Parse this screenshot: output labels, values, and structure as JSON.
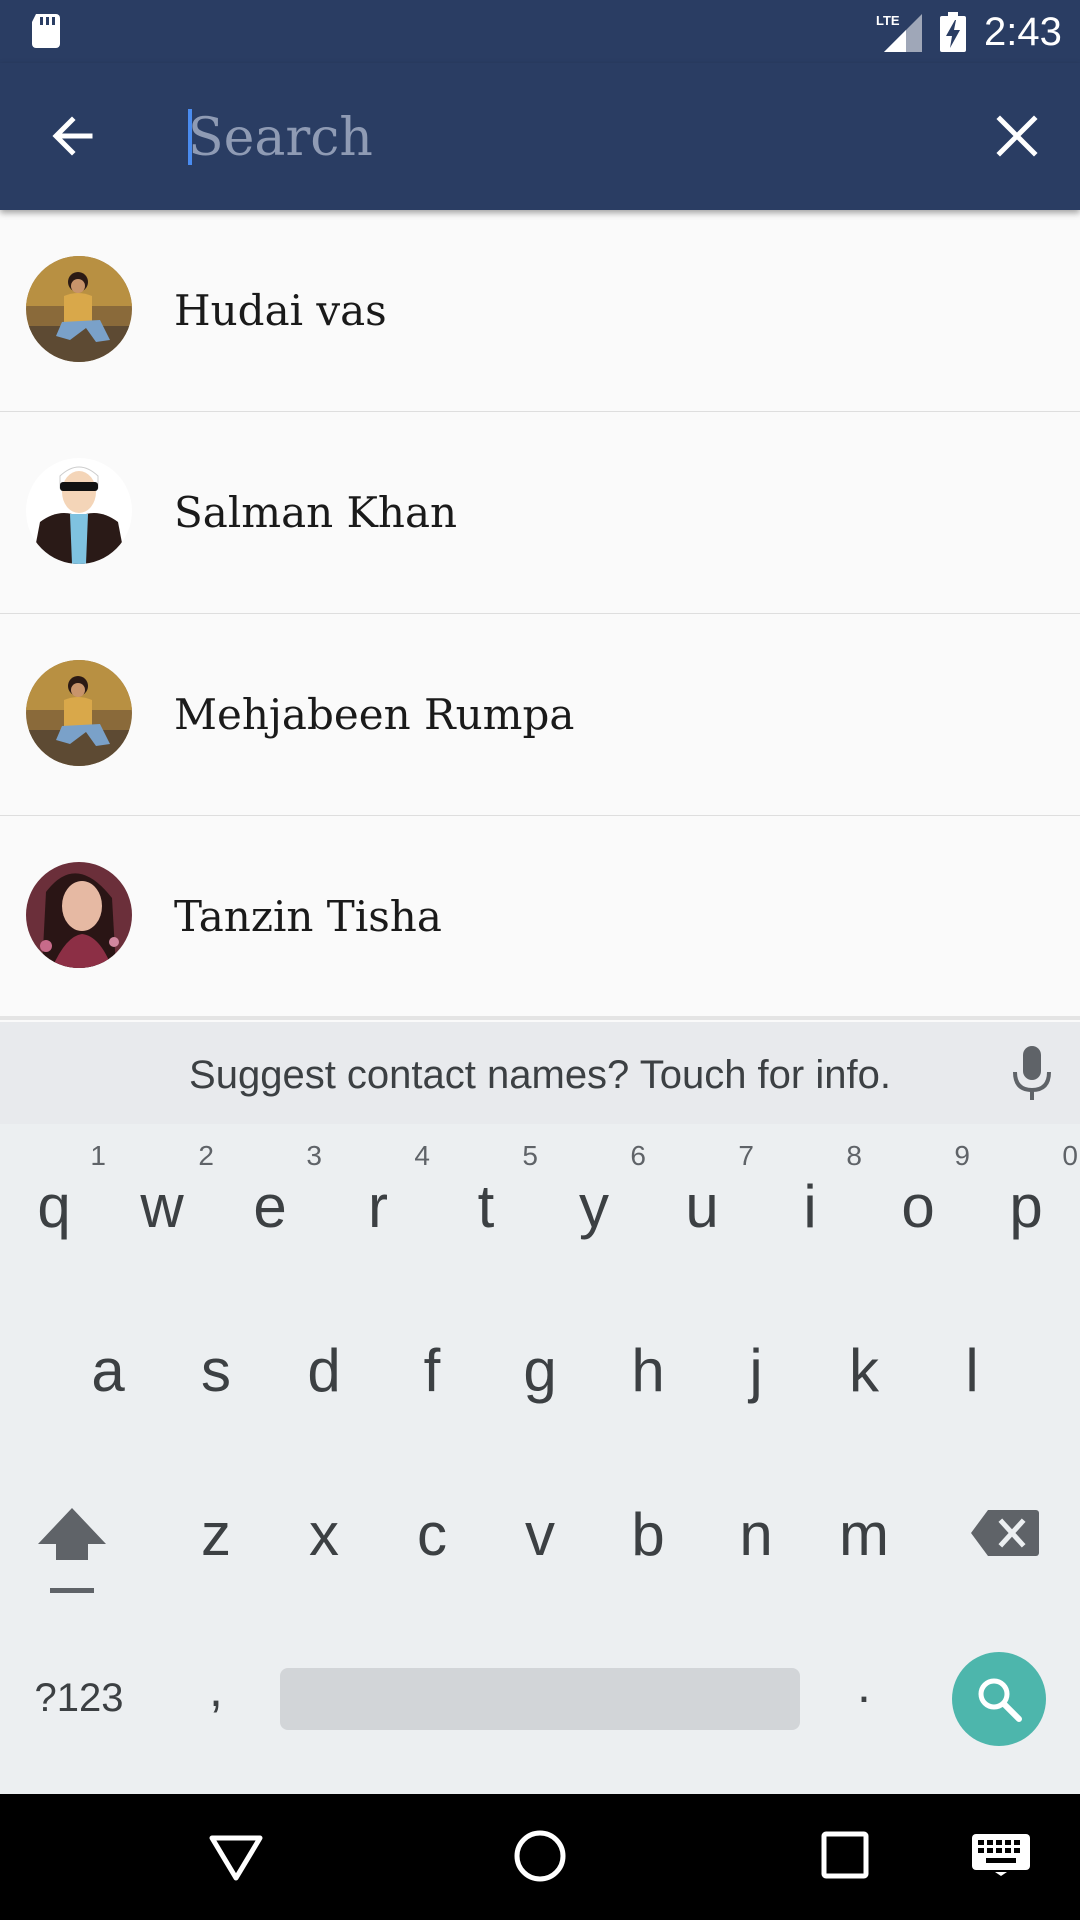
{
  "status_bar": {
    "time": "2:43",
    "network": "LTE",
    "icons": [
      "sd-card-icon",
      "lte-signal-icon",
      "battery-charging-icon"
    ]
  },
  "toolbar": {
    "back_icon": "arrow-back-icon",
    "search_placeholder": "Search",
    "search_value": "",
    "close_icon": "close-icon",
    "background": "#2a3d63"
  },
  "contacts": [
    {
      "name": "Hudai vas",
      "avatar": "photo-woman-sitting"
    },
    {
      "name": "Salman Khan",
      "avatar": "illustration-man-sunglasses"
    },
    {
      "name": "Mehjabeen Rumpa",
      "avatar": "photo-woman-sitting"
    },
    {
      "name": "Tanzin Tisha",
      "avatar": "photo-woman-portrait"
    }
  ],
  "suggestion": {
    "text": "Suggest contact names? Touch for info.",
    "mic_icon": "microphone-icon"
  },
  "keyboard": {
    "row1": [
      "q",
      "w",
      "e",
      "r",
      "t",
      "y",
      "u",
      "i",
      "o",
      "p"
    ],
    "row1_hints": [
      "1",
      "2",
      "3",
      "4",
      "5",
      "6",
      "7",
      "8",
      "9",
      "0"
    ],
    "row2": [
      "a",
      "s",
      "d",
      "f",
      "g",
      "h",
      "j",
      "k",
      "l"
    ],
    "row3": [
      "z",
      "x",
      "c",
      "v",
      "b",
      "n",
      "m"
    ],
    "symbols_label": "?123",
    "comma": ",",
    "period": ".",
    "action_icon": "search-icon",
    "action_color": "#4db6ac"
  },
  "nav_bar": {
    "icons": [
      "nav-back-icon",
      "nav-home-icon",
      "nav-recent-icon",
      "keyboard-switch-icon"
    ]
  }
}
